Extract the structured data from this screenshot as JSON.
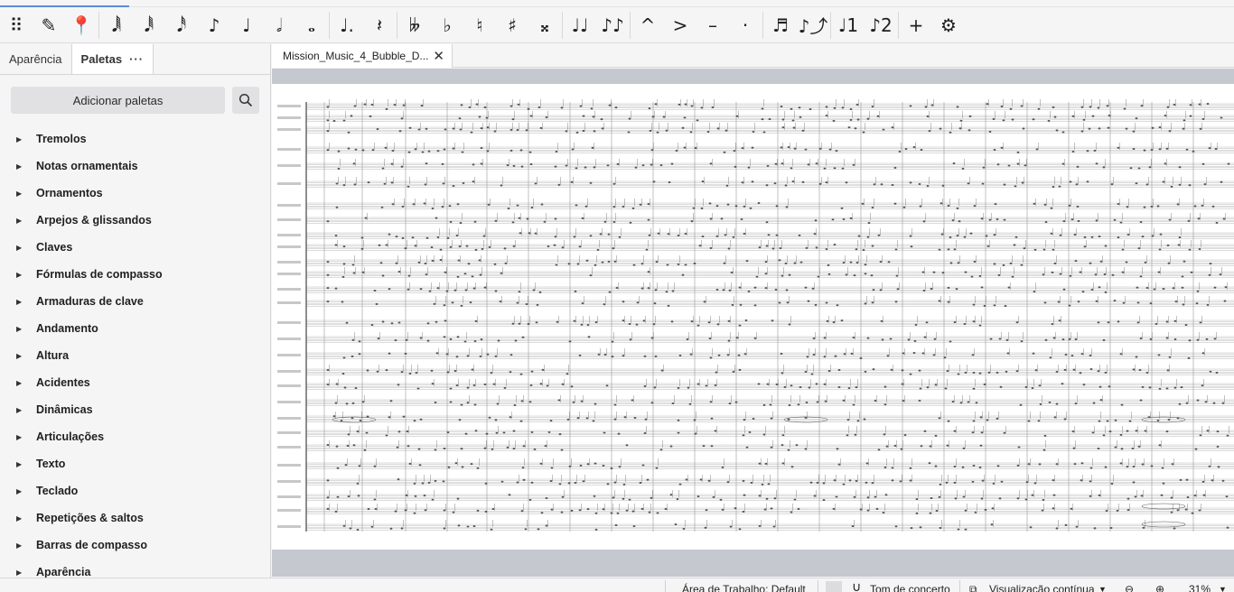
{
  "toolbar": {
    "buttons": [
      {
        "name": "drag-handle-icon",
        "glyph": "⠿"
      },
      {
        "name": "pencil-icon",
        "glyph": "✎"
      },
      {
        "name": "input-mode-icon",
        "glyph": "📍"
      },
      {
        "name": "note-64th-icon",
        "glyph": "𝅘𝅥𝅲"
      },
      {
        "name": "note-32nd-icon",
        "glyph": "𝅘𝅥𝅱"
      },
      {
        "name": "note-16th-icon",
        "glyph": "𝅘𝅥𝅰"
      },
      {
        "name": "note-8th-icon",
        "glyph": "♪"
      },
      {
        "name": "note-quarter-icon",
        "glyph": "♩"
      },
      {
        "name": "note-half-icon",
        "glyph": "𝅗𝅥"
      },
      {
        "name": "note-whole-icon",
        "glyph": "𝅝"
      },
      {
        "name": "augmentation-dot-icon",
        "glyph": "♩."
      },
      {
        "name": "rest-icon",
        "glyph": "𝄽"
      },
      {
        "name": "double-flat-icon",
        "glyph": "𝄫"
      },
      {
        "name": "flat-icon",
        "glyph": "♭"
      },
      {
        "name": "natural-icon",
        "glyph": "♮"
      },
      {
        "name": "sharp-icon",
        "glyph": "♯"
      },
      {
        "name": "double-sharp-icon",
        "glyph": "𝄪"
      },
      {
        "name": "tie-icon",
        "glyph": "♩♩"
      },
      {
        "name": "slur-icon",
        "glyph": "♪♪"
      },
      {
        "name": "marcato-icon",
        "glyph": "^"
      },
      {
        "name": "accent-icon",
        "glyph": ">"
      },
      {
        "name": "tenuto-icon",
        "glyph": "–"
      },
      {
        "name": "staccato-icon",
        "glyph": "·"
      },
      {
        "name": "tuplet-icon",
        "glyph": "♬"
      },
      {
        "name": "flip-direction-icon",
        "glyph": "♪⤴"
      },
      {
        "name": "voice-1-icon",
        "glyph": "♩1"
      },
      {
        "name": "voice-2-icon",
        "glyph": "♪2"
      },
      {
        "name": "add-icon",
        "glyph": "+"
      },
      {
        "name": "settings-icon",
        "glyph": "⚙"
      }
    ]
  },
  "panel": {
    "tab_appearance": "Aparência",
    "tab_palettes": "Paletas",
    "tab_menu": "···",
    "add_palettes": "Adicionar paletas",
    "items": [
      "Tremolos",
      "Notas ornamentais",
      "Ornamentos",
      "Arpejos & glissandos",
      "Claves",
      "Fórmulas de compasso",
      "Armaduras de clave",
      "Andamento",
      "Altura",
      "Acidentes",
      "Dinâmicas",
      "Articulações",
      "Texto",
      "Teclado",
      "Repetições & saltos",
      "Barras de compasso",
      "Aparência"
    ]
  },
  "score": {
    "tab_title": "Mission_Music_4_Bubble_D..."
  },
  "status": {
    "workspace": "Área de Trabalho: Default",
    "concert_pitch": "Tom de concerto",
    "view_mode": "Visualização contínua",
    "zoom": "31%"
  }
}
